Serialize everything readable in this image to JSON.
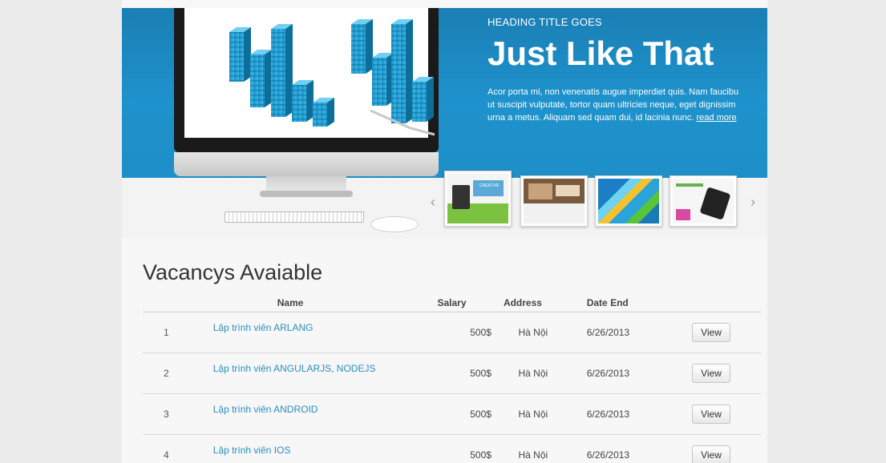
{
  "hero": {
    "kicker": "HEADING TITLE GOES",
    "title": "Just Like That",
    "body_lines": [
      "Acor porta mi, non venenatis augue imperdiet quis. Nam faucibu",
      "ut suscipit vulputate, tortor quam ultricies neque, eget dignissim",
      "urna a metus. Aliquam sed quam dui, id lacinia nunc."
    ],
    "read_more": "read more",
    "prev_arrow": "‹",
    "next_arrow": "›",
    "thumbnails": [
      {
        "name": "thumb-creative",
        "caption": "CREATIVE"
      },
      {
        "name": "thumb-interior",
        "caption": ""
      },
      {
        "name": "thumb-abstract",
        "caption": ""
      },
      {
        "name": "thumb-mobile",
        "caption": ""
      }
    ],
    "colors": {
      "blue": "#1e8fc8",
      "bar_blue": "#2aa3d9"
    }
  },
  "vacancies": {
    "title": "Vacancys Avaiable",
    "columns": {
      "number": "",
      "name": "Name",
      "salary": "Salary",
      "address": "Address",
      "date_end": "Date End",
      "action": ""
    },
    "rows": [
      {
        "num": "1",
        "name": "Lập trình viên ARLANG",
        "salary": "500$",
        "address": "Hà Nội",
        "date_end": "6/26/2013",
        "action": "View"
      },
      {
        "num": "2",
        "name": "Lập trình viên ANGULARJS, NODEJS",
        "salary": "500$",
        "address": "Hà Nội",
        "date_end": "6/26/2013",
        "action": "View"
      },
      {
        "num": "3",
        "name": "Lập trình viên ANDROID",
        "salary": "500$",
        "address": "Hà Nội",
        "date_end": "6/26/2013",
        "action": "View"
      },
      {
        "num": "4",
        "name": "Lập trình viên IOS",
        "salary": "500$",
        "address": "Hà Nội",
        "date_end": "6/26/2013",
        "action": "View"
      }
    ],
    "link_color": "#2a8ec4"
  }
}
